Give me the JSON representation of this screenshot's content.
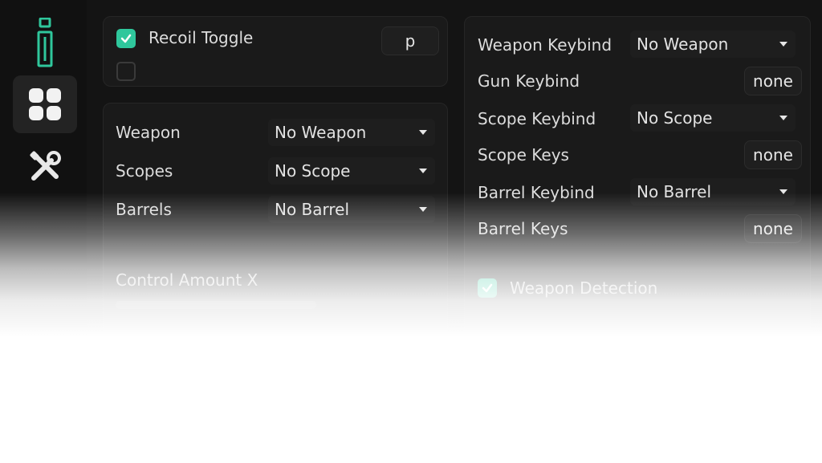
{
  "sidebar": {
    "logo_icon": "logo-icon",
    "items": [
      {
        "icon": "grid-icon",
        "active": true
      },
      {
        "icon": "tools-icon",
        "active": false
      }
    ]
  },
  "recoil_panel": {
    "toggle_label": "Recoil Toggle",
    "toggle_checked": true,
    "key_label": "p",
    "second_checked": false
  },
  "weapon_panel": {
    "rows": [
      {
        "label": "Weapon",
        "value": "No Weapon"
      },
      {
        "label": "Scopes",
        "value": "No Scope"
      },
      {
        "label": "Barrels",
        "value": "No Barrel"
      }
    ]
  },
  "control": {
    "label": "Control Amount X",
    "value_fraction": 1.0
  },
  "keybind_panel": {
    "weapon_keybind_label": "Weapon Keybind",
    "weapon_keybind_value": "No Weapon",
    "gun_keybind_label": "Gun Keybind",
    "gun_keybind_value": "none",
    "scope_keybind_label": "Scope Keybind",
    "scope_keybind_value": "No Scope",
    "scope_keys_label": "Scope Keys",
    "scope_keys_value": "none",
    "barrel_keybind_label": "Barrel Keybind",
    "barrel_keybind_value": "No Barrel",
    "barrel_keys_label": "Barrel Keys",
    "barrel_keys_value": "none"
  },
  "detection": {
    "label": "Weapon Detection",
    "checked": true
  },
  "colors": {
    "accent": "#2fc79c",
    "background": "#141414",
    "panel": "#1a1a1a"
  }
}
